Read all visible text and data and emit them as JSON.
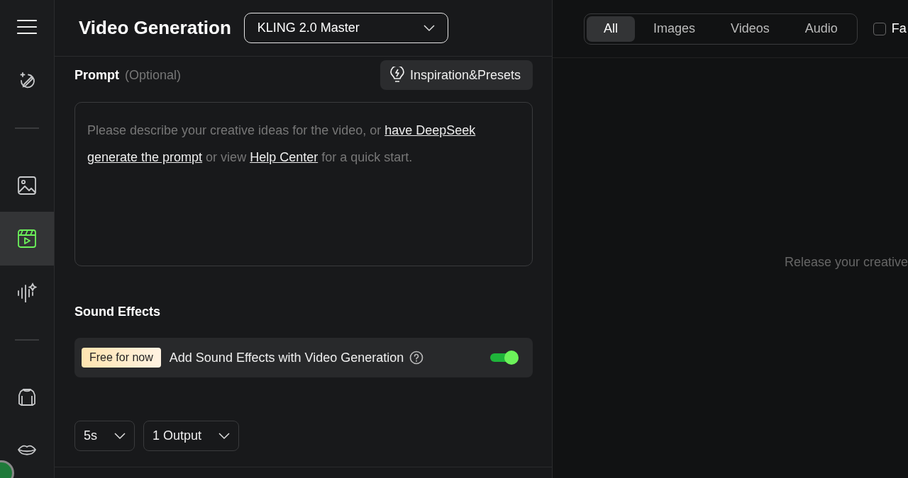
{
  "sidebar": {
    "items": [
      {
        "kind": "magic",
        "selected": false
      },
      {
        "kind": "divider"
      },
      {
        "kind": "image",
        "selected": false
      },
      {
        "kind": "video",
        "selected": true
      },
      {
        "kind": "audio",
        "selected": false
      },
      {
        "kind": "divider"
      },
      {
        "kind": "shirt",
        "selected": false
      },
      {
        "kind": "lips",
        "selected": false
      }
    ]
  },
  "header": {
    "title": "Video Generation",
    "model": "KLING 2.0 Master"
  },
  "prompt": {
    "label": "Prompt",
    "hint": "(Optional)",
    "presets_button": "Inspiration&Presets",
    "placeholder_parts": [
      {
        "kind": "text",
        "text": "Please describe your creative ideas for the video, or "
      },
      {
        "kind": "link",
        "text": "have DeepSeek"
      },
      {
        "kind": "link",
        "text": "generate the prompt"
      },
      {
        "kind": "text",
        "text": " or view "
      },
      {
        "kind": "link",
        "text": "Help Center"
      },
      {
        "kind": "text",
        "text": " for a quick start."
      }
    ]
  },
  "sound_effects": {
    "title": "Sound Effects",
    "badge": "Free for now",
    "label": "Add Sound Effects with Video Generation",
    "on": true
  },
  "options": [
    {
      "value": "5s"
    },
    {
      "value": "1 Output"
    }
  ],
  "filter_tabs": [
    {
      "label": "All",
      "selected": true
    },
    {
      "label": "Images",
      "selected": false
    },
    {
      "label": "Videos",
      "selected": false
    },
    {
      "label": "Audio",
      "selected": false
    }
  ],
  "favorites": {
    "label": "Fa",
    "checked": false
  },
  "empty_state": "Release your creative"
}
